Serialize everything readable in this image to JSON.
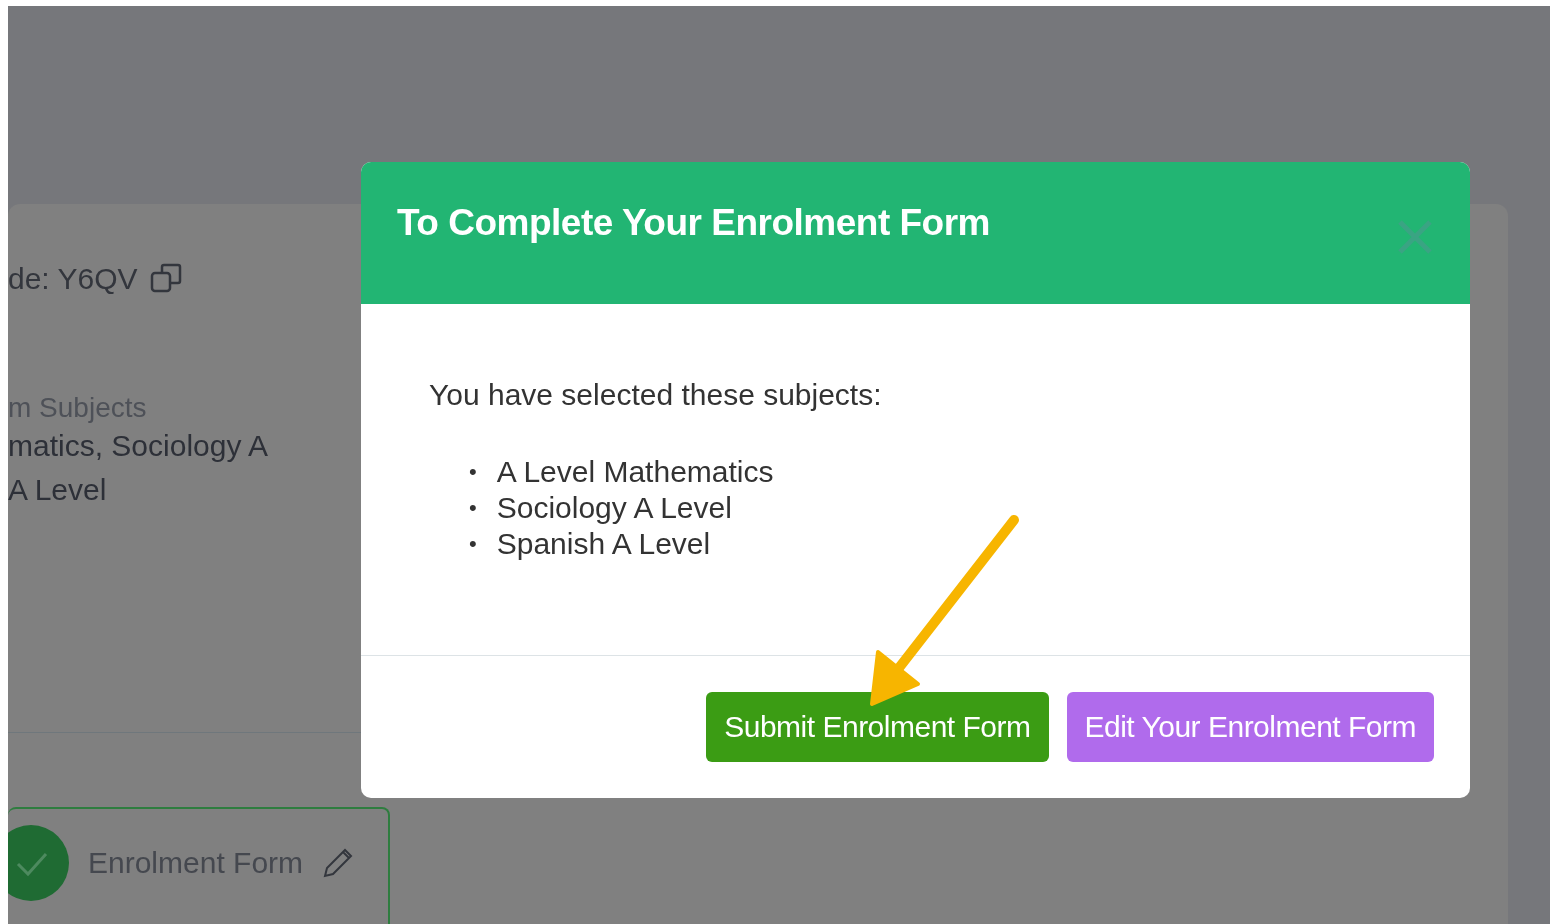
{
  "background": {
    "code_text": "de: Y6QV",
    "subjects_label": "m Subjects",
    "subjects_lines": [
      "matics, Sociology A",
      "A Level"
    ],
    "step": {
      "label": "Enrolment Form",
      "completed": true
    }
  },
  "modal": {
    "title": "To Complete Your Enrolment Form",
    "intro": "You have selected these subjects:",
    "bullet": "•",
    "subjects": [
      "A Level Mathematics",
      "Sociology A Level",
      "Spanish A Level"
    ],
    "buttons": [
      {
        "label": "Submit Enrolment Form",
        "kind": "primary"
      },
      {
        "label": "Edit Your Enrolment Form",
        "kind": "secondary"
      }
    ]
  }
}
